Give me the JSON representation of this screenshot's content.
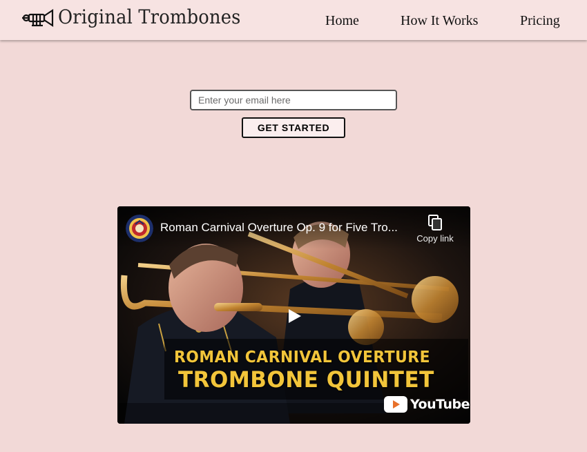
{
  "header": {
    "brand": "Original Trombones",
    "nav": [
      {
        "label": "Home"
      },
      {
        "label": "How It Works"
      },
      {
        "label": "Pricing"
      }
    ]
  },
  "signup": {
    "email_placeholder": "Enter your email here",
    "email_value": "",
    "cta_label": "GET STARTED"
  },
  "video": {
    "title": "Roman Carnival Overture Op. 9 for Five Tro...",
    "copy_link_label": "Copy link",
    "overlay_line1": "ROMAN CARNIVAL OVERTURE",
    "overlay_line2": "TROMBONE QUINTET",
    "platform": "YouTube"
  },
  "colors": {
    "page_bg": "#f2d9d7",
    "header_bg": "#f7e3e2",
    "overlay_text": "#f2c53a"
  },
  "icons": [
    "trumpet-logo-icon",
    "copy-icon",
    "play-icon",
    "youtube-icon"
  ]
}
